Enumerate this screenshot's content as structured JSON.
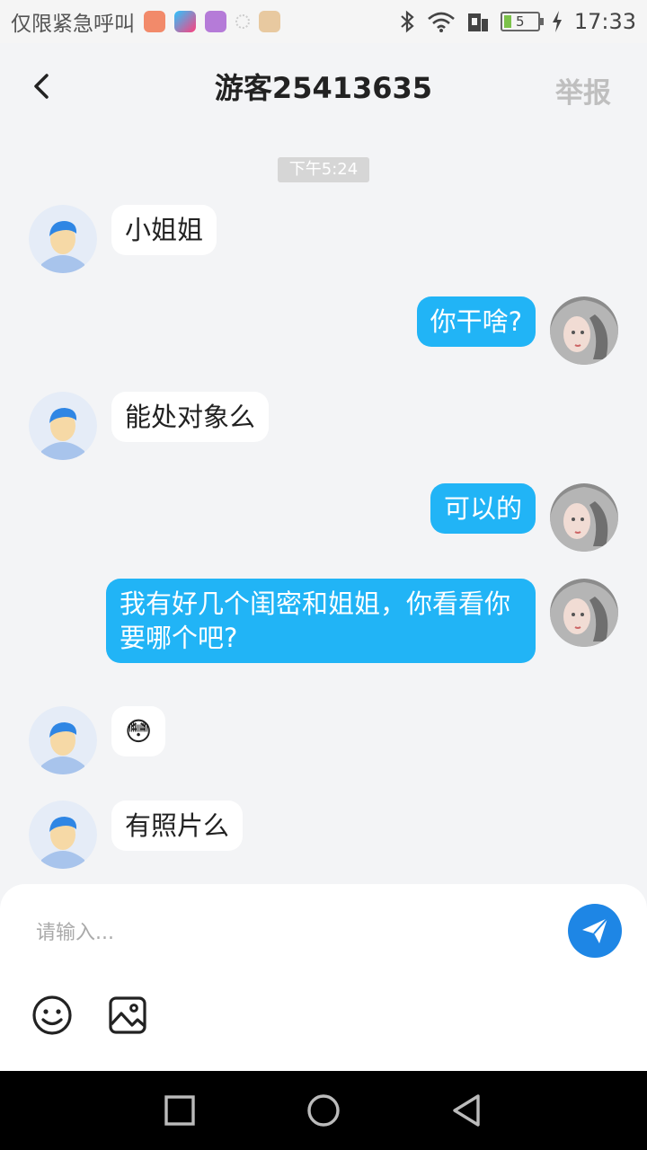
{
  "status_bar": {
    "carrier_text": "仅限紧急呼叫",
    "battery_level": "5",
    "time": "17:33",
    "icons": [
      "mail-app-icon",
      "youku-app-icon",
      "gallery-app-icon",
      "loading-icon",
      "avatar-app-icon",
      "bluetooth-icon",
      "wifi-icon",
      "sim-icon",
      "battery-icon",
      "charging-icon"
    ]
  },
  "header": {
    "title": "游客25413635",
    "report_label": "举报"
  },
  "chat": {
    "timestamp": "下午5:24",
    "messages": [
      {
        "side": "left",
        "text": "小姐姐"
      },
      {
        "side": "right",
        "text": "你干啥?"
      },
      {
        "side": "left",
        "text": "能处对象么"
      },
      {
        "side": "right",
        "text": "可以的"
      },
      {
        "side": "right",
        "text": "我有好几个闺密和姐姐，你看看你要哪个吧?"
      },
      {
        "side": "left",
        "text": "😳"
      },
      {
        "side": "left",
        "text": "有照片么"
      }
    ]
  },
  "composer": {
    "placeholder": "请输入...",
    "value": ""
  },
  "colors": {
    "accent_bubble": "#21b4f6",
    "send_button": "#1e86e5",
    "background": "#f3f4f6"
  }
}
